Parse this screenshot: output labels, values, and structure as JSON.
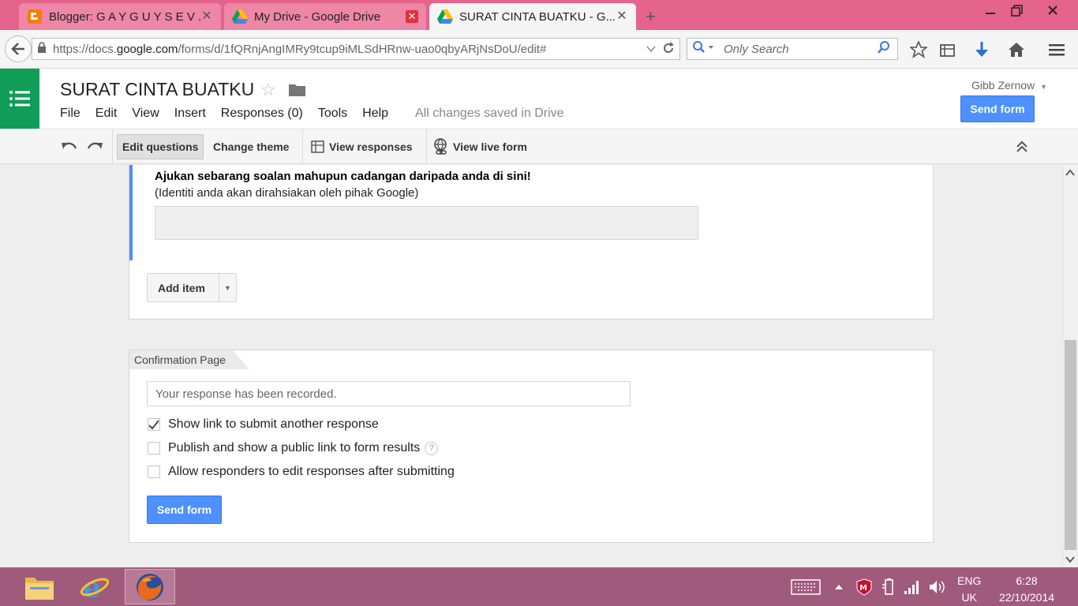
{
  "browser": {
    "tabs": [
      {
        "label": "Blogger: G A Y G U Y S E V ...",
        "icon": "blogger-icon",
        "close": "✕"
      },
      {
        "label": "My Drive - Google Drive",
        "icon": "drive-icon",
        "close": "✕"
      },
      {
        "label": "SURAT CINTA BUATKU - G...",
        "icon": "drive-icon",
        "close": "✕"
      }
    ],
    "new_tab": "+",
    "url_prefix": "https://docs.",
    "url_domain": "google.com",
    "url_path": "/forms/d/1fQRnjAngIMRy9tcup9iMLSdHRnw-uao0qbyARjNsDoU/edit#",
    "search_placeholder": "Only Search"
  },
  "doc": {
    "title": "SURAT CINTA BUATKU",
    "menu": [
      "File",
      "Edit",
      "View",
      "Insert",
      "Responses (0)",
      "Tools",
      "Help"
    ],
    "save_status": "All changes saved in Drive",
    "user": "Gibb Zernow",
    "send_form": "Send form"
  },
  "toolbar": {
    "edit_questions": "Edit questions",
    "change_theme": "Change theme",
    "view_responses": "View responses",
    "view_live_form": "View live form"
  },
  "question": {
    "title": "Ajukan sebarang soalan mahupun cadangan daripada anda di sini!",
    "help": "(Identiti anda akan dirahsiakan oleh pihak Google)",
    "add_item": "Add item"
  },
  "confirmation": {
    "tab_label": "Confirmation Page",
    "message": "Your response has been recorded.",
    "options": [
      {
        "label": "Show link to submit another response",
        "checked": true
      },
      {
        "label": "Publish and show a public link to form results",
        "checked": false,
        "help": "?"
      },
      {
        "label": "Allow responders to edit responses after submitting",
        "checked": false
      }
    ],
    "send_form": "Send form"
  },
  "taskbar": {
    "lang_top": "ENG",
    "lang_bottom": "UK",
    "time": "6:28",
    "date": "22/10/2014"
  },
  "colors": {
    "tabbar": "#e4648c",
    "primary_blue": "#4d90fe",
    "sheets_green": "#0f9d58",
    "taskbar": "#a05a7c"
  }
}
